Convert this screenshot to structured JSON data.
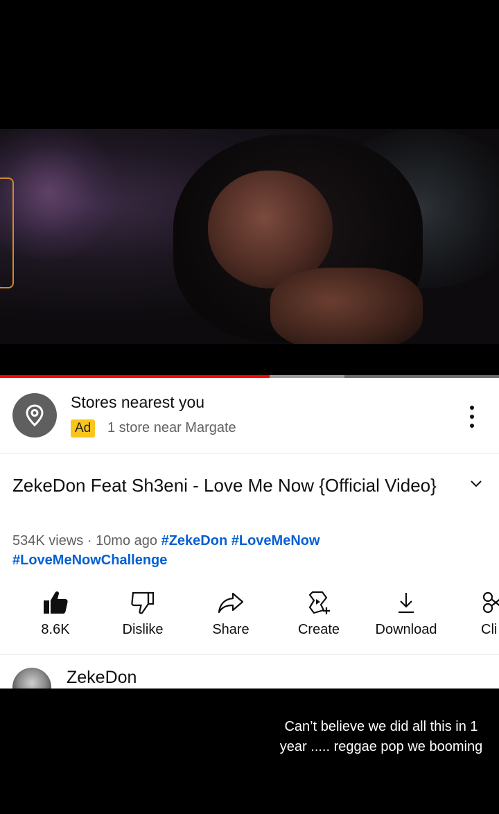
{
  "player": {
    "progress_fraction": 0.54,
    "buffered_fraction": 0.69
  },
  "ad": {
    "title": "Stores nearest you",
    "badge": "Ad",
    "subtitle": "1 store near Margate",
    "icon": "location-pin-icon"
  },
  "video": {
    "title": "ZekeDon Feat Sh3eni - Love Me Now {Official Video}",
    "views": "534K views",
    "separator": " · ",
    "age": "10mo ago",
    "hashtags": [
      "#ZekeDon",
      "#LoveMeNow",
      "#LoveMeNowChallenge"
    ]
  },
  "actions": [
    {
      "label": "8.6K",
      "icon": "thumbs-up-icon"
    },
    {
      "label": "Dislike",
      "icon": "thumbs-down-icon"
    },
    {
      "label": "Share",
      "icon": "share-icon"
    },
    {
      "label": "Create",
      "icon": "create-icon"
    },
    {
      "label": "Download",
      "icon": "download-icon"
    },
    {
      "label": "Cli",
      "icon": "clip-icon"
    }
  ],
  "channel": {
    "name": "ZekeDon"
  },
  "overlay_caption": "Can’t believe we did all this in 1 year ..... reggae pop we booming",
  "colors": {
    "progress": "#ff0000",
    "hashtag": "#065fd4",
    "ad_badge": "#f9c51a"
  }
}
